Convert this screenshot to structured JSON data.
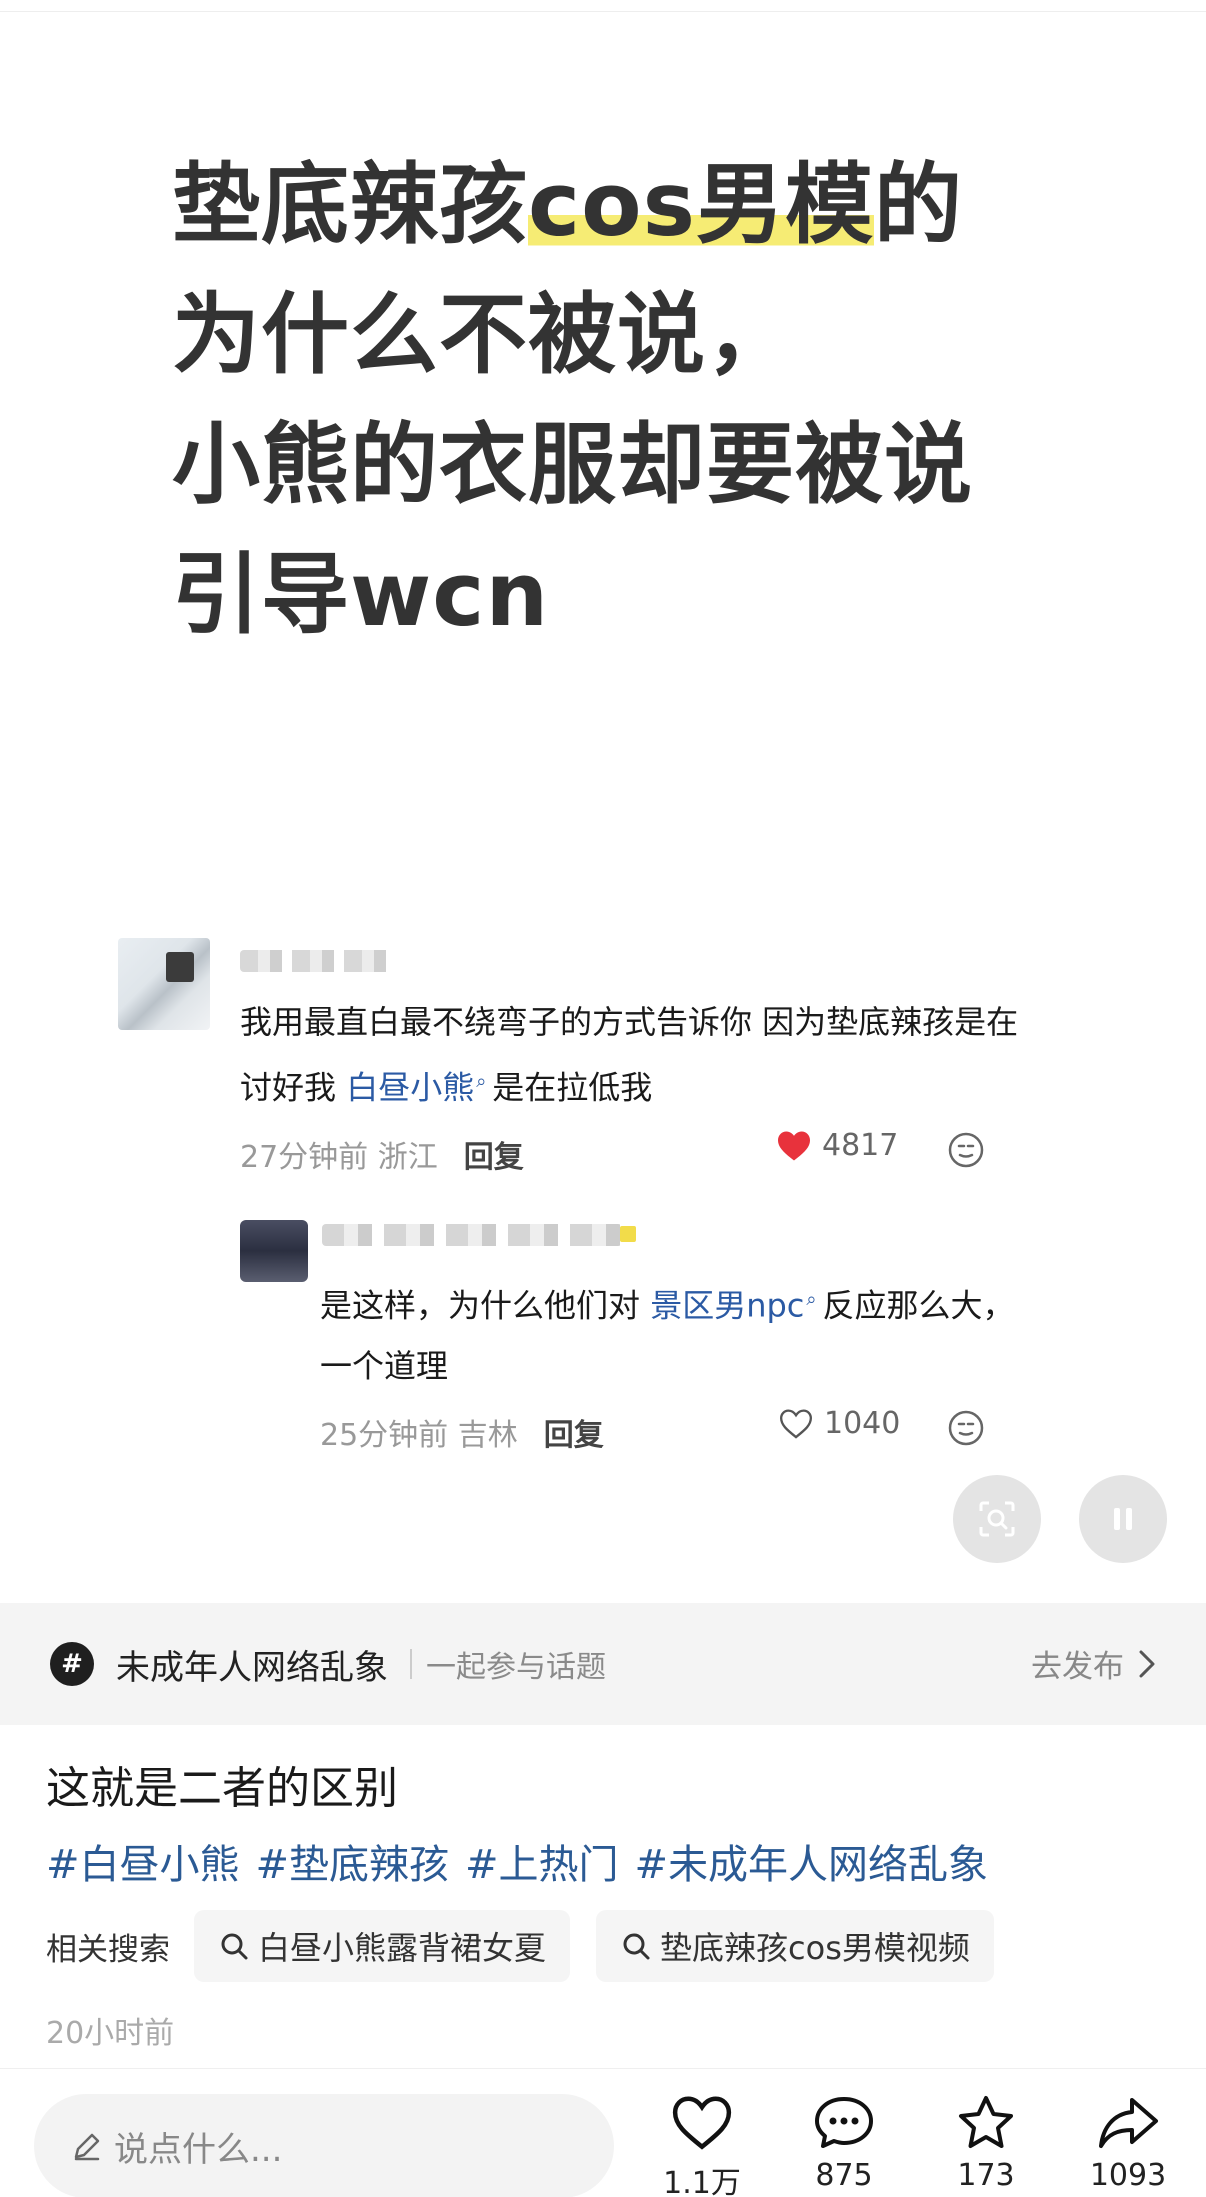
{
  "headline": {
    "line1_plain": "垫底辣孩",
    "line1_marked": "cos男模",
    "line1_tail": "的",
    "line2": "为什么不被说，",
    "line3": "小熊的衣服却要被说",
    "line4": "引导wcn"
  },
  "comments": [
    {
      "text_before": "我用最直白最不绕弯子的方式告诉你 因为垫底辣孩是在讨好我 ",
      "mention": "白昼小熊",
      "text_after": "是在拉低我",
      "time": "27分钟前",
      "location": "浙江",
      "reply_label": "回复",
      "likes": "4817",
      "liked": true
    },
    {
      "text_before": "是这样，为什么他们对 ",
      "mention": "景区男npc",
      "text_after": "反应那么大，一个道理",
      "time": "25分钟前",
      "location": "吉林",
      "reply_label": "回复",
      "likes": "1040",
      "liked": false
    }
  ],
  "topic": {
    "icon": "#",
    "name": "未成年人网络乱象",
    "join_label": "一起参与话题",
    "publish_label": "去发布"
  },
  "description": {
    "title": "这就是二者的区别",
    "hashtags": [
      "#白昼小熊",
      "#垫底辣孩",
      "#上热门",
      "#未成年人网络乱象"
    ],
    "related_label": "相关搜索",
    "related_searches": [
      "白昼小熊露背裙女夏",
      "垫底辣孩cos男模视频"
    ],
    "time_ago": "20小时前"
  },
  "bottom_bar": {
    "comment_placeholder": "说点什么...",
    "likes": "1.1万",
    "comments": "875",
    "favorites": "173",
    "shares": "1093"
  },
  "colors": {
    "highlight": "#f6ec74",
    "mention": "#2b5aa4",
    "hashtag": "#2b5a94",
    "liked_heart": "#e8323c"
  },
  "icons": [
    "heart-filled-icon",
    "heart-outline-icon",
    "emoji-icon",
    "scan-icon",
    "pause-icon",
    "chevron-right-icon",
    "search-icon",
    "pencil-icon",
    "comment-bubble-icon",
    "star-icon",
    "share-arrow-icon"
  ]
}
